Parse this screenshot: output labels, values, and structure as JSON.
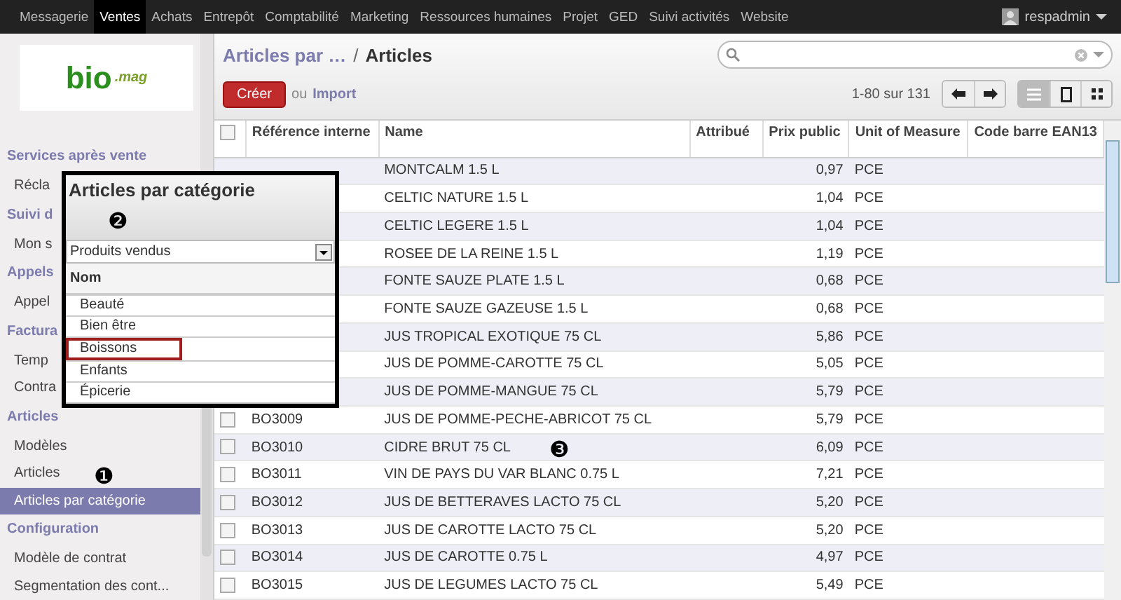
{
  "top_menu": [
    {
      "label": "Messagerie",
      "selected": false
    },
    {
      "label": "Ventes",
      "selected": true
    },
    {
      "label": "Achats",
      "selected": false
    },
    {
      "label": "Entrepôt",
      "selected": false
    },
    {
      "label": "Comptabilité",
      "selected": false
    },
    {
      "label": "Marketing",
      "selected": false
    },
    {
      "label": "Ressources humaines",
      "selected": false
    },
    {
      "label": "Projet",
      "selected": false
    },
    {
      "label": "GED",
      "selected": false
    },
    {
      "label": "Suivi activités",
      "selected": false
    },
    {
      "label": "Website",
      "selected": false
    }
  ],
  "user": {
    "name": "respadmin"
  },
  "logo": {
    "text": "bio",
    "subtext": ".mag"
  },
  "sidebar": {
    "items": [
      {
        "kind": "section",
        "label": "Services après vente"
      },
      {
        "kind": "item",
        "label": "Récla",
        "selected": false
      },
      {
        "kind": "section",
        "label": "Suivi d"
      },
      {
        "kind": "item",
        "label": "Mon s",
        "selected": false
      },
      {
        "kind": "section",
        "label": "Appels"
      },
      {
        "kind": "item",
        "label": "Appel",
        "selected": false
      },
      {
        "kind": "section",
        "label": "Factura"
      },
      {
        "kind": "item",
        "label": "Temp",
        "selected": false
      },
      {
        "kind": "item",
        "label": "Contra",
        "selected": false
      },
      {
        "kind": "section",
        "label": "Articles"
      },
      {
        "kind": "item",
        "label": "Modèles",
        "selected": false
      },
      {
        "kind": "item",
        "label": "Articles",
        "selected": false
      },
      {
        "kind": "item",
        "label": "Articles par catégorie",
        "selected": true
      },
      {
        "kind": "section",
        "label": "Configuration"
      },
      {
        "kind": "item",
        "label": "Modèle de contrat",
        "selected": false
      },
      {
        "kind": "item",
        "label": "Segmentation des cont...",
        "selected": false
      }
    ]
  },
  "breadcrumb": {
    "parent": "Articles par …",
    "separator": "/",
    "current": "Articles"
  },
  "toolbar": {
    "create": "Créer",
    "or": "ou",
    "import": "Import",
    "pager": "1-80 sur 131"
  },
  "table": {
    "select_all_checked": false,
    "columns": [
      "Référence interne",
      "Name",
      "Attribué",
      "Prix public",
      "Unit of Measure",
      "Code barre EAN13"
    ],
    "rows": [
      {
        "name": "MONTCALM 1.5 L",
        "price": "0,97",
        "uom": "PCE"
      },
      {
        "name": "CELTIC NATURE 1.5 L",
        "price": "1,04",
        "uom": "PCE"
      },
      {
        "name": "CELTIC LEGERE 1.5 L",
        "price": "1,04",
        "uom": "PCE"
      },
      {
        "name": "ROSEE DE LA REINE 1.5 L",
        "price": "1,19",
        "uom": "PCE"
      },
      {
        "name": "FONTE SAUZE PLATE 1.5 L",
        "price": "0,68",
        "uom": "PCE"
      },
      {
        "name": "FONTE SAUZE GAZEUSE 1.5 L",
        "price": "0,68",
        "uom": "PCE"
      },
      {
        "name": "JUS TROPICAL EXOTIQUE 75 CL",
        "price": "5,86",
        "uom": "PCE"
      },
      {
        "name": "JUS DE POMME-CAROTTE 75 CL",
        "price": "5,05",
        "uom": "PCE"
      },
      {
        "name": "JUS DE POMME-MANGUE 75 CL",
        "price": "5,79",
        "uom": "PCE"
      },
      {
        "ref": "BO3009",
        "checked": false,
        "name": "JUS DE POMME-PECHE-ABRICOT 75 CL",
        "price": "5,79",
        "uom": "PCE"
      },
      {
        "ref": "BO3010",
        "checked": false,
        "name": "CIDRE BRUT 75 CL",
        "price": "6,09",
        "uom": "PCE"
      },
      {
        "ref": "BO3011",
        "checked": false,
        "name": "VIN DE PAYS DU VAR BLANC 0.75 L",
        "price": "7,21",
        "uom": "PCE"
      },
      {
        "ref": "BO3012",
        "checked": false,
        "name": "JUS DE BETTERAVES LACTO 75 CL",
        "price": "5,20",
        "uom": "PCE"
      },
      {
        "ref": "BO3013",
        "checked": false,
        "name": "JUS DE CAROTTE LACTO 75 CL",
        "price": "5,20",
        "uom": "PCE"
      },
      {
        "ref": "BO3014",
        "checked": false,
        "name": "JUS DE CAROTTE 0.75 L",
        "price": "4,97",
        "uom": "PCE"
      },
      {
        "ref": "BO3015",
        "checked": false,
        "name": "JUS DE LEGUMES LACTO 75 CL",
        "price": "5,49",
        "uom": "PCE"
      }
    ]
  },
  "popup": {
    "title": "Articles par catégorie",
    "select_value": "Produits vendus",
    "column": "Nom",
    "items": [
      {
        "label": "Beauté",
        "selected": false
      },
      {
        "label": "Bien être",
        "selected": false
      },
      {
        "label": "Boissons",
        "selected": true
      },
      {
        "label": "Enfants",
        "selected": false
      },
      {
        "label": "Épicerie",
        "selected": false
      }
    ]
  },
  "callouts": [
    {
      "label": "❶"
    },
    {
      "label": "❷"
    },
    {
      "label": "❸"
    }
  ]
}
